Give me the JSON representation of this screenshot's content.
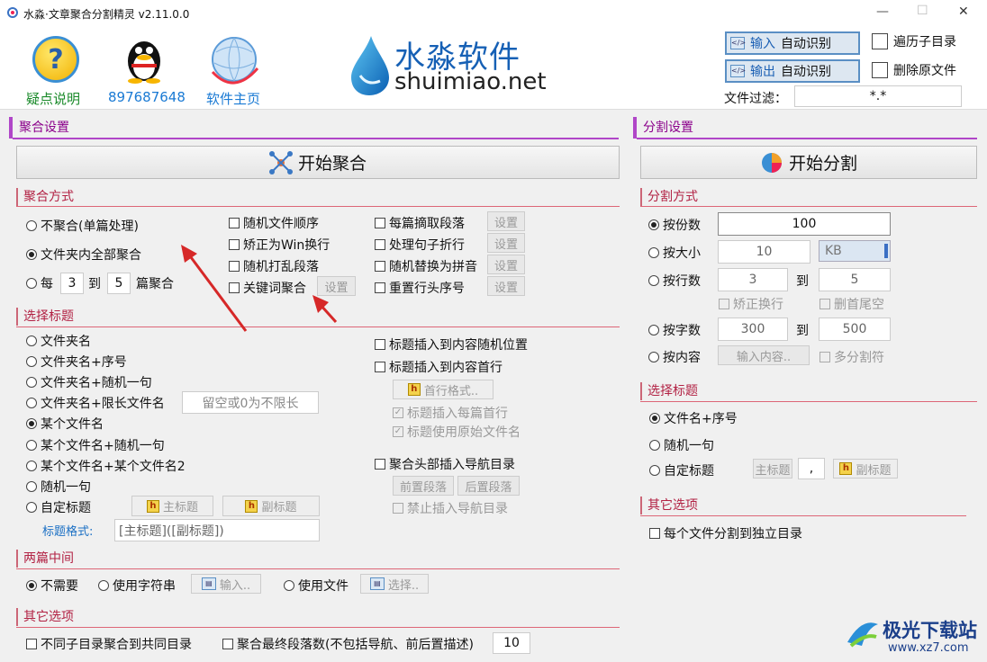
{
  "window": {
    "title": "水淼·文章聚合分割精灵 v2.11.0.0",
    "min": "—",
    "max": "☐",
    "close": "✕"
  },
  "top": {
    "help": "疑点说明",
    "qq": "897687648",
    "home": "软件主页",
    "brand_cn": "水淼软件",
    "brand_en": "shuimiao.net",
    "input_btn": "输入",
    "input_auto": "自动识别",
    "output_btn": "输出",
    "output_auto": "自动识别",
    "traverse": "遍历子目录",
    "delete_src": "删除原文件",
    "filter_label": "文件过滤：",
    "filter_value": "*.*"
  },
  "left": {
    "section": "聚合设置",
    "start_btn": "开始聚合",
    "mode": {
      "title": "聚合方式",
      "r1": "不聚合(单篇处理)",
      "r2": "文件夹内全部聚合",
      "r3_a": "每",
      "r3_from": "3",
      "r3_to_lbl": "到",
      "r3_to": "5",
      "r3_b": "篇聚合",
      "c1": "随机文件顺序",
      "c2": "矫正为Win换行",
      "c3": "随机打乱段落",
      "c4": "关键词聚合",
      "c4_btn": "设置",
      "c5": "每篇摘取段落",
      "c6": "处理句子折行",
      "c7": "随机替换为拼音",
      "c8": "重置行头序号",
      "set": "设置"
    },
    "title_sel": {
      "title": "选择标题",
      "r1": "文件夹名",
      "r2": "文件夹名+序号",
      "r3": "文件夹名+随机一句",
      "r4": "文件夹名+限长文件名",
      "r4_ph": "留空或0为不限长",
      "r5": "某个文件名",
      "r6": "某个文件名+随机一句",
      "r7": "某个文件名+某个文件名2",
      "r8": "随机一句",
      "r9": "自定标题",
      "main_title": "主标题",
      "sub_title": "副标题",
      "fmt_label": "标题格式:",
      "fmt_value": "[主标题]([副标题])",
      "c1": "标题插入到内容随机位置",
      "c2": "标题插入到内容首行",
      "first_fmt": "首行格式..",
      "c3": "标题插入每篇首行",
      "c4": "标题使用原始文件名",
      "c5": "聚合头部插入导航目录",
      "prev": "前置段落",
      "next": "后置段落",
      "c6": "禁止插入导航目录"
    },
    "between": {
      "title": "两篇中间",
      "r1": "不需要",
      "r2": "使用字符串",
      "input": "输入..",
      "r3": "使用文件",
      "choose": "选择.."
    },
    "other": {
      "title": "其它选项",
      "c1": "不同子目录聚合到共同目录",
      "c2": "聚合最终段落数(不包括导航、前后置描述)",
      "count": "10"
    }
  },
  "right": {
    "section": "分割设置",
    "start_btn": "开始分割",
    "mode": {
      "title": "分割方式",
      "r1": "按份数",
      "r1_val": "100",
      "r2": "按大小",
      "r2_val": "10",
      "unit": "KB",
      "r3": "按行数",
      "r3_from": "3",
      "to": "到",
      "r3_to": "5",
      "c1": "矫正换行",
      "c2": "删首尾空",
      "r4": "按字数",
      "r4_from": "300",
      "r4_to": "500",
      "r5": "按内容",
      "content_btn": "输入内容..",
      "c3": "多分割符"
    },
    "title_sel": {
      "title": "选择标题",
      "r1": "文件名+序号",
      "r2": "随机一句",
      "r3": "自定标题",
      "main_title": "主标题",
      "sep": ",",
      "sub_title": "副标题"
    },
    "other": {
      "title": "其它选项",
      "c1": "每个文件分割到独立目录"
    }
  },
  "watermark": {
    "cn": "极光下载站",
    "url": "www.xz7.com"
  }
}
